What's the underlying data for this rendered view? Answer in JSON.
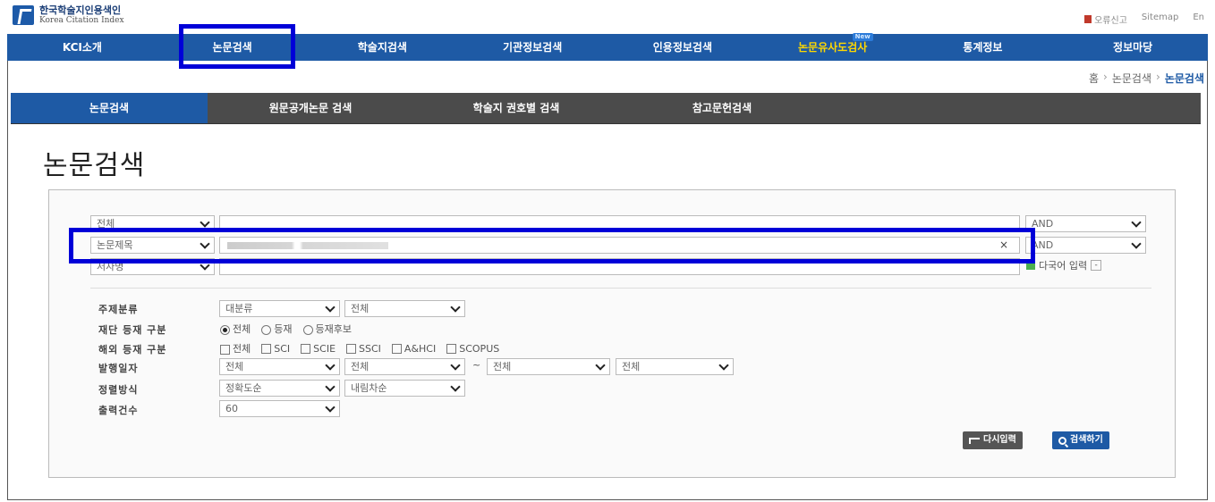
{
  "header": {
    "logo_ko": "한국학술지인용색인",
    "logo_en": "Korea Citation Index",
    "util_error": "오류신고",
    "util_sitemap": "Sitemap",
    "util_lang": "En"
  },
  "gnb": {
    "items": [
      {
        "label": "KCI소개"
      },
      {
        "label": "논문검색"
      },
      {
        "label": "학술지검색"
      },
      {
        "label": "기관정보검색"
      },
      {
        "label": "인용정보검색"
      },
      {
        "label": "논문유사도검사",
        "badge": "New"
      },
      {
        "label": "통계정보"
      },
      {
        "label": "정보마당"
      }
    ]
  },
  "breadcrumb": {
    "home": "홈",
    "sep": "›",
    "level1": "논문검색",
    "current": "논문검색"
  },
  "subtabs": [
    "논문검색",
    "원문공개논문 검색",
    "학술지 권호별 검색",
    "참고문헌검색"
  ],
  "page_title": "논문검색",
  "search": {
    "rows": [
      {
        "field": "전체",
        "value": "",
        "op": "AND"
      },
      {
        "field": "논문제목",
        "value": "",
        "op": "AND",
        "clear": "×"
      },
      {
        "field": "저자명",
        "value": ""
      }
    ],
    "multilang": "다국어 입력",
    "multilang_btn": "-"
  },
  "filters": {
    "subject_label": "주제분류",
    "subject_main": "대분류",
    "subject_sub": "전체",
    "reg_label": "재단 등재 구분",
    "reg_options": [
      {
        "label": "전체",
        "on": true
      },
      {
        "label": "등재",
        "on": false
      },
      {
        "label": "등재후보",
        "on": false
      }
    ],
    "foreign_label": "해외 등재 구분",
    "foreign_options": [
      "전체",
      "SCI",
      "SCIE",
      "SSCI",
      "A&HCI",
      "SCOPUS"
    ],
    "date_label": "발행일자",
    "date_from_year": "전체",
    "date_from_month": "전체",
    "date_tilde": "~",
    "date_to_year": "전체",
    "date_to_month": "전체",
    "sort_label": "정렬방식",
    "sort_field": "정확도순",
    "sort_order": "내림차순",
    "count_label": "출력건수",
    "count_value": "60"
  },
  "buttons": {
    "reset": "다시입력",
    "search": "검색하기"
  },
  "colors": {
    "nav_blue": "#1e5aa5",
    "highlight_yellow": "#ffd800",
    "annotation_blue": "#0000d8",
    "subtab_dark": "#4b4b4b"
  }
}
